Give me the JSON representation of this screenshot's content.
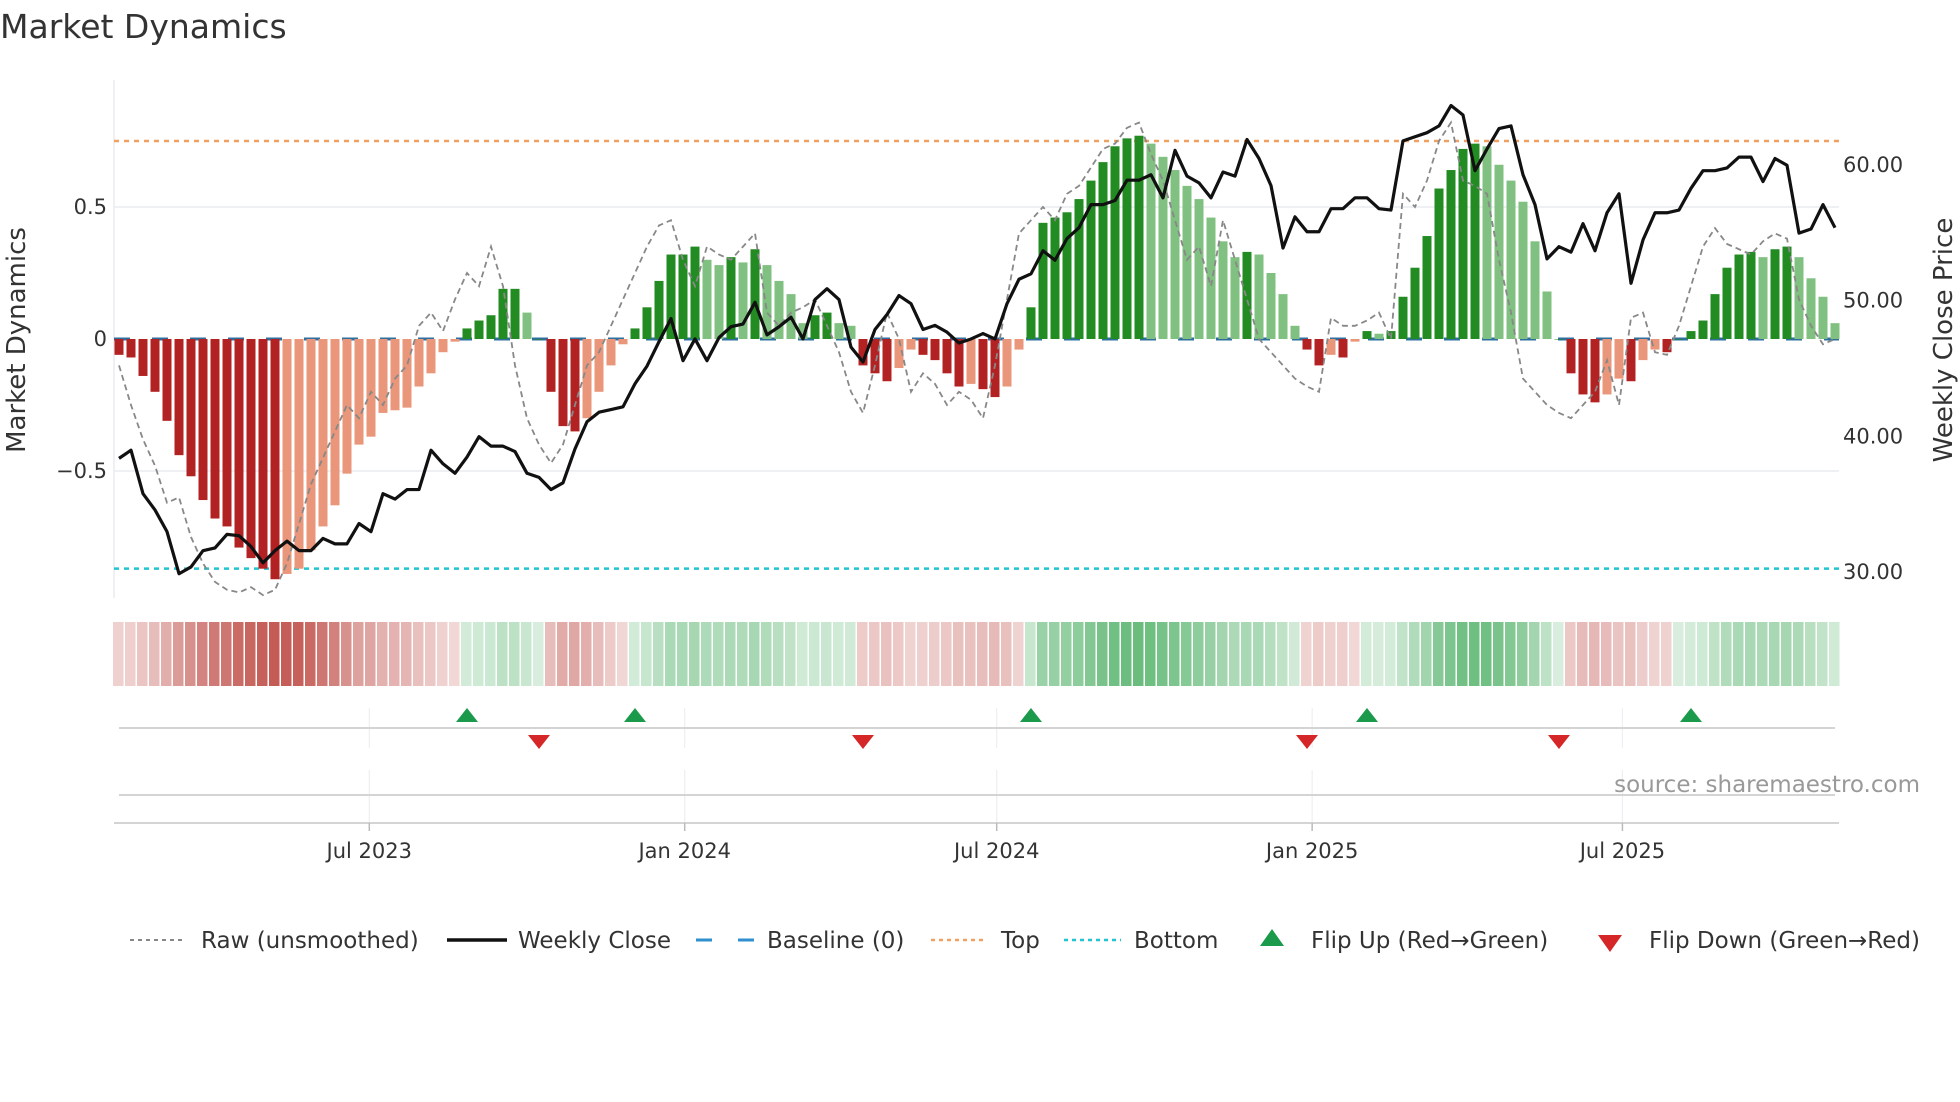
{
  "chart_data": {
    "type": "bar",
    "title": "Market Dynamics",
    "ylabel": "Market Dynamics",
    "y2label": "Weekly Close Price",
    "ylim": [
      -0.95,
      0.92
    ],
    "y2lim": [
      27.7,
      69.8
    ],
    "yticks": [
      {
        "value": 0.5,
        "label": "0.5"
      },
      {
        "value": 0,
        "label": "0"
      },
      {
        "value": -0.5,
        "label": "−0.5"
      }
    ],
    "y2ticks": [
      {
        "value": 60,
        "label": "60.00"
      },
      {
        "value": 50,
        "label": "50.00"
      },
      {
        "value": 40,
        "label": "40.00"
      },
      {
        "value": 30,
        "label": "30.00"
      }
    ],
    "xticks": [
      {
        "date": "2023-07-01",
        "label": "Jul 2023"
      },
      {
        "date": "2024-01-01",
        "label": "Jan 2024"
      },
      {
        "date": "2024-07-01",
        "label": "Jul 2024"
      },
      {
        "date": "2025-01-01",
        "label": "Jan 2025"
      },
      {
        "date": "2025-07-01",
        "label": "Jul 2025"
      }
    ],
    "start_date": "2023-02-05",
    "interval_days": 7,
    "top_level": 0.75,
    "bottom_level": -0.87,
    "baseline": 0,
    "series": [
      {
        "name": "Market Dynamics (smoothed)",
        "kind": "bar",
        "values": [
          -0.06,
          -0.07,
          -0.14,
          -0.2,
          -0.31,
          -0.44,
          -0.52,
          -0.61,
          -0.68,
          -0.71,
          -0.79,
          -0.83,
          -0.87,
          -0.91,
          -0.89,
          -0.87,
          -0.8,
          -0.71,
          -0.63,
          -0.51,
          -0.4,
          -0.37,
          -0.28,
          -0.27,
          -0.26,
          -0.18,
          -0.13,
          -0.05,
          -0.01,
          0.04,
          0.07,
          0.09,
          0.19,
          0.19,
          0.1,
          0.0,
          -0.2,
          -0.33,
          -0.35,
          -0.3,
          -0.2,
          -0.1,
          -0.02,
          0.04,
          0.12,
          0.22,
          0.32,
          0.32,
          0.35,
          0.3,
          0.28,
          0.31,
          0.29,
          0.34,
          0.28,
          0.22,
          0.17,
          0.06,
          0.09,
          0.1,
          0.06,
          0.05,
          -0.1,
          -0.13,
          -0.16,
          -0.11,
          -0.04,
          -0.06,
          -0.08,
          -0.13,
          -0.18,
          -0.17,
          -0.19,
          -0.22,
          -0.18,
          -0.04,
          0.12,
          0.44,
          0.46,
          0.48,
          0.53,
          0.6,
          0.67,
          0.73,
          0.76,
          0.77,
          0.74,
          0.69,
          0.64,
          0.58,
          0.53,
          0.46,
          0.37,
          0.31,
          0.33,
          0.32,
          0.25,
          0.17,
          0.05,
          -0.04,
          -0.1,
          -0.06,
          -0.07,
          -0.01,
          0.03,
          0.02,
          0.03,
          0.16,
          0.27,
          0.39,
          0.57,
          0.64,
          0.72,
          0.74,
          0.73,
          0.66,
          0.6,
          0.52,
          0.37,
          0.18,
          0.0,
          -0.13,
          -0.21,
          -0.24,
          -0.21,
          -0.15,
          -0.16,
          -0.08,
          -0.04,
          -0.05,
          0.0,
          0.03,
          0.07,
          0.17,
          0.27,
          0.32,
          0.33,
          0.31,
          0.34,
          0.35,
          0.31,
          0.23,
          0.16,
          0.06
        ]
      },
      {
        "name": "Raw (unsmoothed)",
        "kind": "line",
        "values": [
          -0.1,
          -0.25,
          -0.38,
          -0.48,
          -0.62,
          -0.6,
          -0.75,
          -0.85,
          -0.92,
          -0.95,
          -0.96,
          -0.94,
          -0.97,
          -0.95,
          -0.85,
          -0.7,
          -0.55,
          -0.45,
          -0.35,
          -0.25,
          -0.3,
          -0.2,
          -0.25,
          -0.15,
          -0.1,
          0.05,
          0.1,
          0.03,
          0.15,
          0.25,
          0.2,
          0.35,
          0.2,
          -0.1,
          -0.3,
          -0.4,
          -0.47,
          -0.4,
          -0.25,
          -0.1,
          -0.05,
          0.05,
          0.15,
          0.25,
          0.35,
          0.43,
          0.45,
          0.3,
          0.2,
          0.35,
          0.32,
          0.3,
          0.35,
          0.4,
          0.1,
          0.05,
          0.1,
          0.12,
          0.15,
          0.05,
          -0.05,
          -0.2,
          -0.28,
          -0.1,
          0.1,
          0.0,
          -0.2,
          -0.13,
          -0.17,
          -0.25,
          -0.2,
          -0.23,
          -0.3,
          -0.1,
          0.15,
          0.4,
          0.45,
          0.5,
          0.45,
          0.55,
          0.58,
          0.65,
          0.72,
          0.74,
          0.8,
          0.82,
          0.7,
          0.6,
          0.45,
          0.3,
          0.35,
          0.2,
          0.45,
          0.3,
          0.15,
          0.0,
          -0.05,
          -0.1,
          -0.15,
          -0.18,
          -0.2,
          0.08,
          0.05,
          0.05,
          0.07,
          0.1,
          0.0,
          0.55,
          0.5,
          0.6,
          0.75,
          0.82,
          0.6,
          0.58,
          0.55,
          0.3,
          0.1,
          -0.15,
          -0.2,
          -0.25,
          -0.28,
          -0.3,
          -0.25,
          -0.2,
          -0.08,
          -0.25,
          0.08,
          0.1,
          -0.05,
          -0.06,
          0.05,
          0.2,
          0.35,
          0.42,
          0.36,
          0.34,
          0.32,
          0.37,
          0.4,
          0.38,
          0.15,
          0.05,
          -0.02,
          0.0
        ]
      },
      {
        "name": "Weekly Close",
        "kind": "line",
        "axis": "right",
        "values": [
          38.3,
          38.9,
          35.7,
          34.5,
          32.9,
          29.8,
          30.3,
          31.5,
          31.7,
          32.7,
          32.6,
          31.8,
          30.6,
          31.5,
          32.2,
          31.5,
          31.5,
          32.4,
          32.0,
          32.0,
          33.5,
          32.9,
          35.7,
          35.3,
          36.0,
          36.0,
          38.9,
          37.9,
          37.2,
          38.4,
          39.9,
          39.2,
          39.2,
          38.8,
          37.2,
          36.9,
          36.0,
          36.5,
          39.0,
          41.0,
          41.7,
          41.9,
          42.1,
          43.8,
          45.1,
          46.9,
          48.6,
          45.5,
          47.1,
          45.5,
          47.2,
          48.0,
          48.2,
          49.8,
          47.4,
          48.0,
          48.7,
          47.1,
          50.0,
          50.8,
          50.0,
          46.5,
          45.4,
          47.8,
          48.9,
          50.3,
          49.7,
          47.8,
          48.1,
          47.6,
          46.8,
          47.1,
          47.5,
          47.1,
          49.7,
          51.5,
          51.9,
          53.6,
          52.9,
          54.5,
          55.3,
          57.0,
          57.0,
          57.3,
          58.8,
          58.8,
          59.2,
          57.5,
          61.0,
          59.1,
          58.6,
          57.5,
          59.4,
          59.1,
          61.8,
          60.4,
          58.4,
          53.8,
          56.1,
          55.0,
          55.0,
          56.7,
          56.7,
          57.5,
          57.5,
          56.7,
          56.6,
          61.7,
          62.0,
          62.3,
          62.8,
          64.3,
          63.6,
          59.5,
          61.1,
          62.6,
          62.8,
          59.2,
          57.0,
          53.0,
          53.9,
          53.5,
          55.6,
          53.6,
          56.4,
          57.8,
          51.2,
          54.4,
          56.4,
          56.4,
          56.6,
          58.2,
          59.5,
          59.5,
          59.7,
          60.5,
          60.5,
          58.7,
          60.4,
          59.9,
          54.9,
          55.2,
          57.0,
          55.3
        ]
      }
    ],
    "flip_up_weeks": [
      29,
      43,
      76,
      104,
      131
    ],
    "flip_down_weeks": [
      35,
      62,
      99,
      120
    ],
    "legend_position": "bottom",
    "legend": [
      "Raw (unsmoothed)",
      "Weekly Close",
      "Baseline (0)",
      "Top",
      "Bottom",
      "Flip Up (Red→Green)",
      "Flip Down (Green→Red)"
    ],
    "source": "source: sharemaestro.com",
    "colors": {
      "bar_pos_strong": "#228b22",
      "bar_pos_weak": "#80c080",
      "bar_neg_strong": "#b22222",
      "bar_neg_weak": "#e9967a",
      "raw": "#888888",
      "price": "#111111",
      "baseline": "#2f6f9f",
      "top": "#f0a060",
      "bottom": "#22c4d0",
      "flip_up": "#1a9a4a",
      "flip_down": "#d62728",
      "strip_pos": "#4caf63",
      "strip_neg": "#c0504a"
    }
  }
}
